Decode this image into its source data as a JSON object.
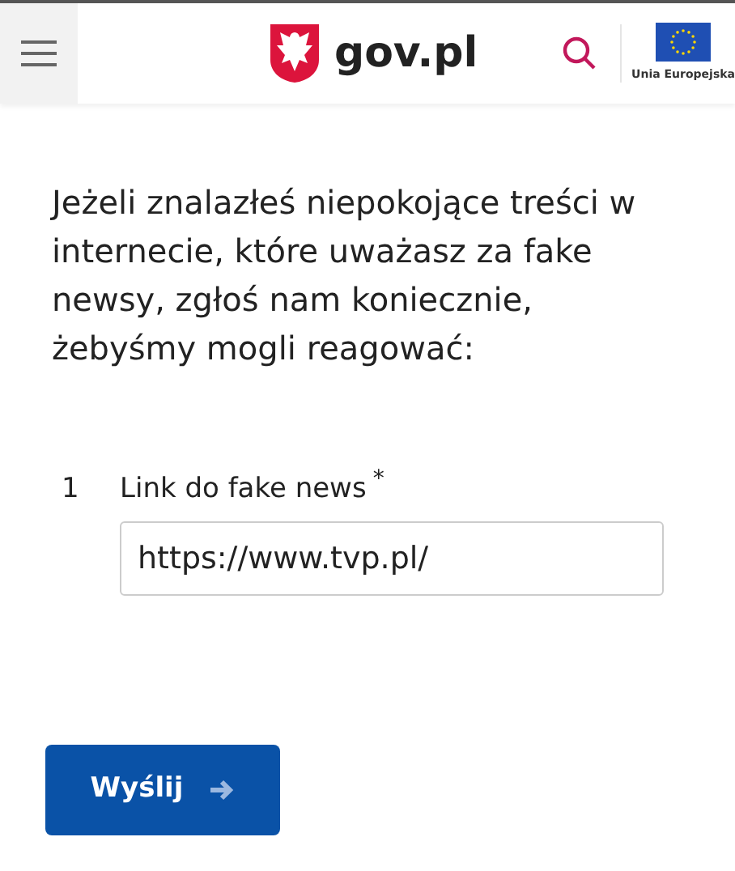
{
  "header": {
    "logo_text": "gov.pl",
    "eu_label": "Unia Europejska"
  },
  "intro": "Jeżeli znalazłeś niepokojące treści w internecie, które uważasz za fake newsy, zgłoś nam koniecznie, żebyśmy mogli reagować:",
  "question": {
    "number": "1",
    "label": "Link do fake news",
    "required_mark": "*",
    "value": "https://www.tvp.pl/"
  },
  "submit": {
    "label": "Wyślij"
  }
}
